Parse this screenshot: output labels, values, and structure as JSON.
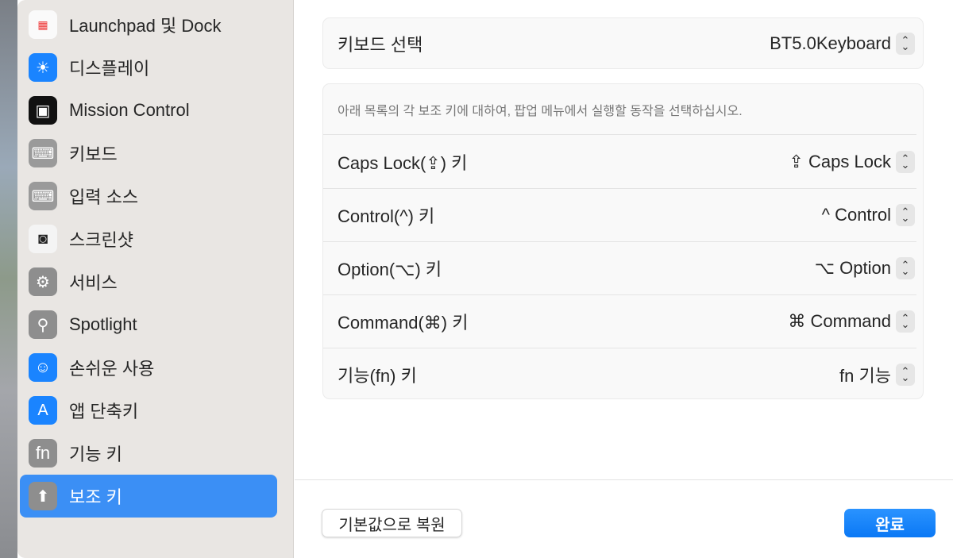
{
  "sidebar": {
    "items": [
      {
        "label": "Launchpad 및 Dock",
        "icon": "launchpad-icon"
      },
      {
        "label": "디스플레이",
        "icon": "sun-icon"
      },
      {
        "label": "Mission Control",
        "icon": "mission-control-icon"
      },
      {
        "label": "키보드",
        "icon": "keyboard-icon"
      },
      {
        "label": "입력 소스",
        "icon": "keyboard-icon"
      },
      {
        "label": "스크린샷",
        "icon": "camera-icon"
      },
      {
        "label": "서비스",
        "icon": "gears-icon"
      },
      {
        "label": "Spotlight",
        "icon": "magnifier-icon"
      },
      {
        "label": "손쉬운 사용",
        "icon": "accessibility-icon"
      },
      {
        "label": "앱 단축키",
        "icon": "app-store-icon"
      },
      {
        "label": "기능 키",
        "icon": "fn-icon",
        "glyph": "fn"
      },
      {
        "label": "보조 키",
        "icon": "shift-arrow-icon",
        "selected": true
      }
    ]
  },
  "keyboard_select": {
    "label": "키보드 선택",
    "value": "BT5.0Keyboard"
  },
  "modifiers": {
    "description": "아래 목록의 각 보조 키에 대하여, 팝업 메뉴에서 실행할 동작을 선택하십시오.",
    "rows": [
      {
        "label": "Caps Lock(⇪) 키",
        "value": "⇪ Caps Lock"
      },
      {
        "label": "Control(^) 키",
        "value": "^ Control"
      },
      {
        "label": "Option(⌥) 키",
        "value": "⌥ Option"
      },
      {
        "label": "Command(⌘) 키",
        "value": "⌘ Command"
      },
      {
        "label": "기능(fn) 키",
        "value": "fn 기능"
      }
    ]
  },
  "footer": {
    "reset_label": "기본값으로 복원",
    "done_label": "완료"
  },
  "colors": {
    "accent": "#3b8ff5",
    "done": "#0a78f5"
  }
}
